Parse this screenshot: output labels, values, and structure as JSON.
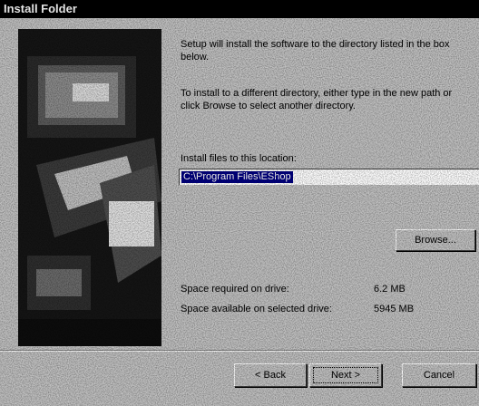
{
  "window": {
    "title": "Install Folder"
  },
  "intro": {
    "line1": "Setup will install the software to the directory listed in the box below.",
    "line2": "To install to a different directory, either type in the new path or click Browse to select another directory."
  },
  "location": {
    "label": "Install files to this location:",
    "value": "C:\\Program Files\\EShop"
  },
  "buttons": {
    "browse": "Browse...",
    "back": "< Back",
    "next": "Next >",
    "cancel": "Cancel"
  },
  "space": {
    "required_label": "Space required on drive:",
    "required_value": "6.2 MB",
    "available_label": "Space available on selected drive:",
    "available_value": "5945 MB"
  },
  "colors": {
    "titlebar": "#000000",
    "dialog_bg": "#c0c0c0",
    "selection": "#000080"
  }
}
